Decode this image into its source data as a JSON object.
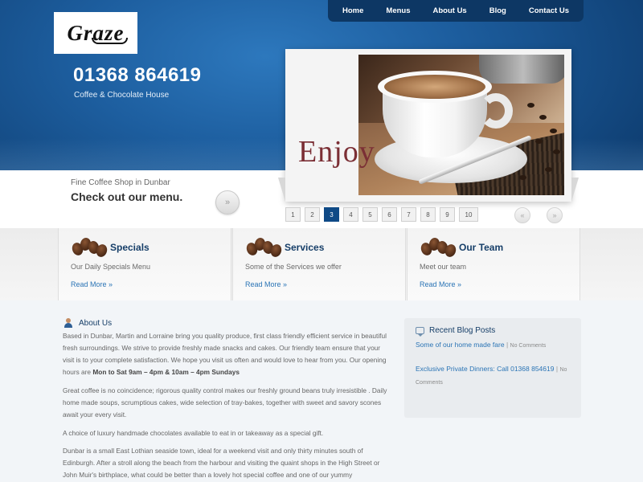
{
  "header": {
    "logo_text": "Graze",
    "phone": "01368 864619",
    "tagline": "Coffee & Chocolate House"
  },
  "nav": {
    "items": [
      "Home",
      "Menus",
      "About Us",
      "Blog",
      "Contact Us"
    ]
  },
  "intro": {
    "kicker": "Fine Coffee Shop in Dunbar",
    "headline": "Check out our menu.",
    "arrow": "»"
  },
  "slider": {
    "caption": "Enjoy",
    "pages": [
      "1",
      "2",
      "3",
      "4",
      "5",
      "6",
      "7",
      "8",
      "9",
      "10"
    ],
    "active_page": "3",
    "prev": "«",
    "next": "»"
  },
  "features": [
    {
      "title": "Specials",
      "desc": "Our Daily Specials Menu",
      "link": "Read More »"
    },
    {
      "title": "Services",
      "desc": "Some of the Services we offer",
      "link": "Read More »"
    },
    {
      "title": "Our Team",
      "desc": "Meet our team",
      "link": "Read More »"
    }
  ],
  "about": {
    "title": "About Us",
    "p1": "Based in Dunbar, Martin and Lorraine bring you quality produce, first class friendly efficient service in beautiful fresh surroundings.  We strive to provide freshly made snacks and cakes.  Our friendly team ensure that your visit is to your complete satisfaction.  We hope you visit us often and would love to hear from you. Our opening hours are ",
    "p1_bold": "Mon to Sat 9am – 4pm & 10am – 4pm Sundays",
    "p2": "Great coffee is no coincidence; rigorous quality control makes our freshly ground beans truly irresistible . Daily home made soups, scrumptious cakes, wide selection of tray-bakes, together with sweet and savory scones await your every visit.",
    "p3": "A choice of luxury handmade chocolates available to eat in or takeaway as a special gift.",
    "p4": "Dunbar is a small East Lothian seaside town, ideal for a weekend visit and only thirty minutes south of Edinburgh. After a stroll along the beach from the harbour and visiting the quaint shops in the High Street or John Muir's birthplace, what could be better than a lovely hot special coffee and one of our yummy"
  },
  "blog": {
    "title": "Recent Blog Posts",
    "posts": [
      {
        "title": "Some of our home made fare",
        "meta": "No Comments"
      },
      {
        "title": "Exclusive Private Dinners: Call 01368 854619",
        "meta": "No Comments"
      }
    ],
    "separator": "|"
  },
  "colors": {
    "header_blue": "#1d5e9f",
    "nav_dark": "#0d3764",
    "active_page": "#0f4a86",
    "link_blue": "#2a74b5",
    "caption_red": "#7b2f35"
  }
}
